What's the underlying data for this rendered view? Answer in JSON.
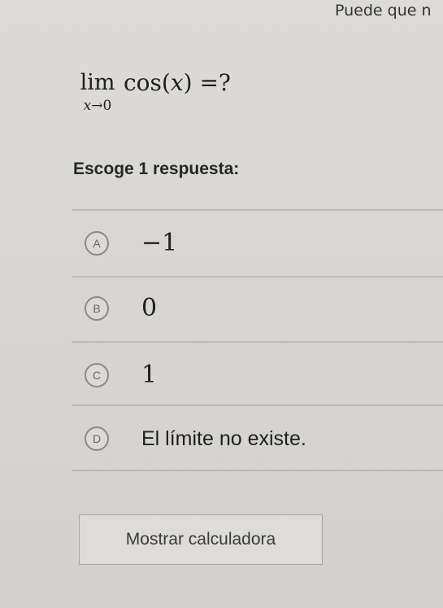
{
  "hint_text": "Puede que n",
  "question": {
    "lim_word": "lim",
    "lim_sub_var": "x",
    "lim_sub_arrow": "→",
    "lim_sub_target": "0",
    "expr_fn": "cos(",
    "expr_var": "x",
    "expr_close": ") =?"
  },
  "prompt": "Escoge 1 respuesta:",
  "options": [
    {
      "letter": "A",
      "text": "−1"
    },
    {
      "letter": "B",
      "text": "0"
    },
    {
      "letter": "C",
      "text": "1"
    },
    {
      "letter": "D",
      "text": "El límite no existe."
    }
  ],
  "calculator_button": "Mostrar calculadora"
}
